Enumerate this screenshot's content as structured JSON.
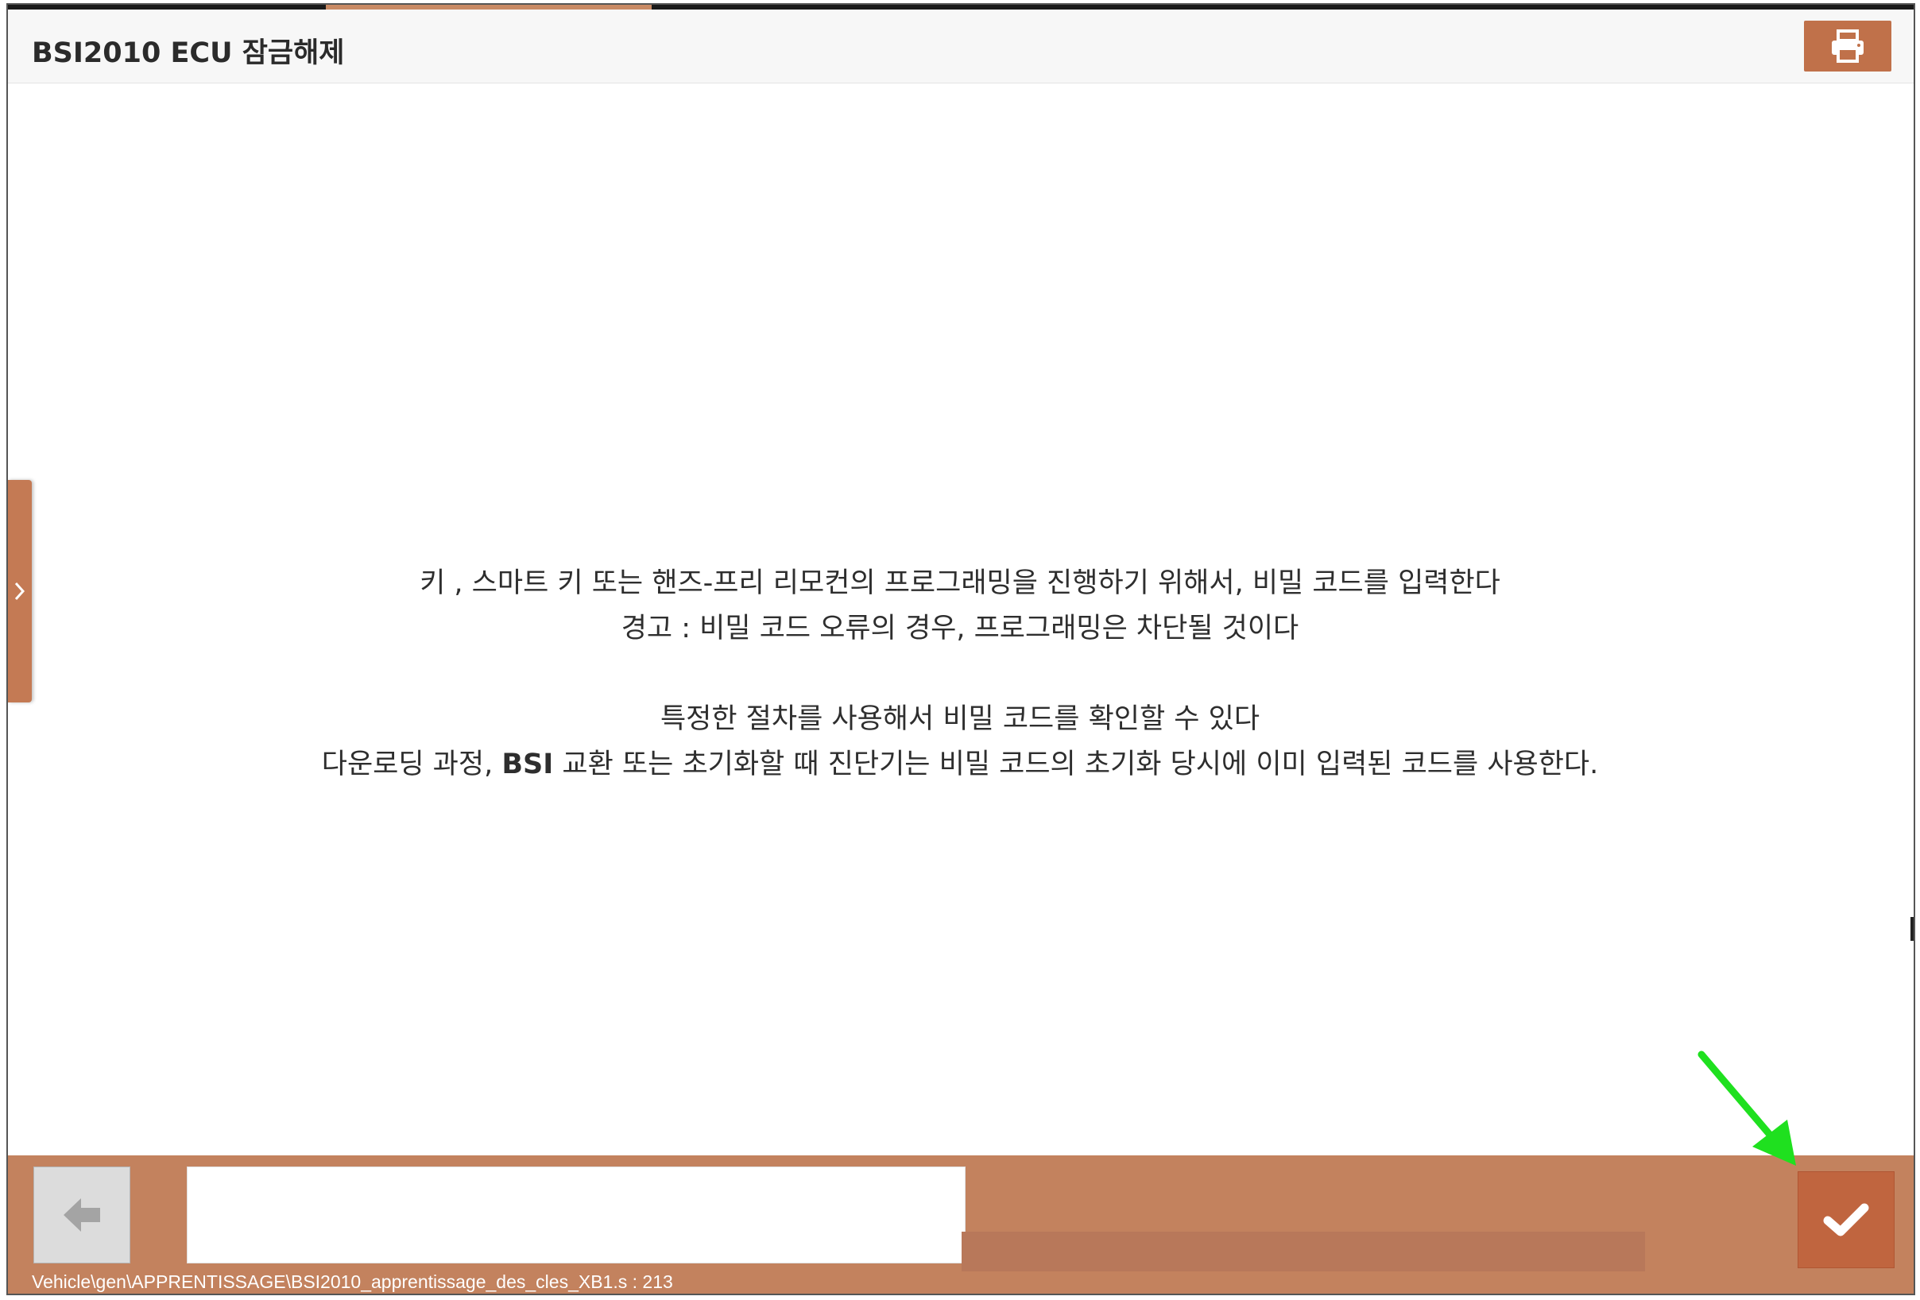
{
  "header": {
    "title": "BSI2010 ECU 잠금해제",
    "print_icon": "printer-icon"
  },
  "sidebar_toggle": {
    "icon": "chevron-right-icon"
  },
  "message": {
    "line1": "키 , 스마트 키 또는 핸즈-프리 리모컨의 프로그래밍을 진행하기 위해서, 비밀 코드를 입력한다",
    "line2": "경고 : 비밀 코드 오류의 경우, 프로그래밍은 차단될 것이다",
    "line3": "특정한 절차를 사용해서 비밀 코드를 확인할 수 있다",
    "line4_pre": "다운로딩 과정,",
    "line4_bold": "BSI",
    "line4_post": "교환 또는 초기화할 때 진단기는 비밀 코드의 초기화 당시에 이미 입력된 코드를 사용한다."
  },
  "footer": {
    "back_icon": "arrow-left-icon",
    "input_value": "",
    "confirm_icon": "checkmark-icon",
    "status_path": "Vehicle\\gen\\APPRENTISSAGE\\BSI2010_apprentissage_des_cles_XB1.s : 213"
  },
  "annotation": {
    "icon": "green-arrow-icon",
    "color": "#1fe01f"
  },
  "colors": {
    "accent": "#c0714a",
    "footer_bg": "#c3825e",
    "confirm_bg": "#c0653f"
  }
}
